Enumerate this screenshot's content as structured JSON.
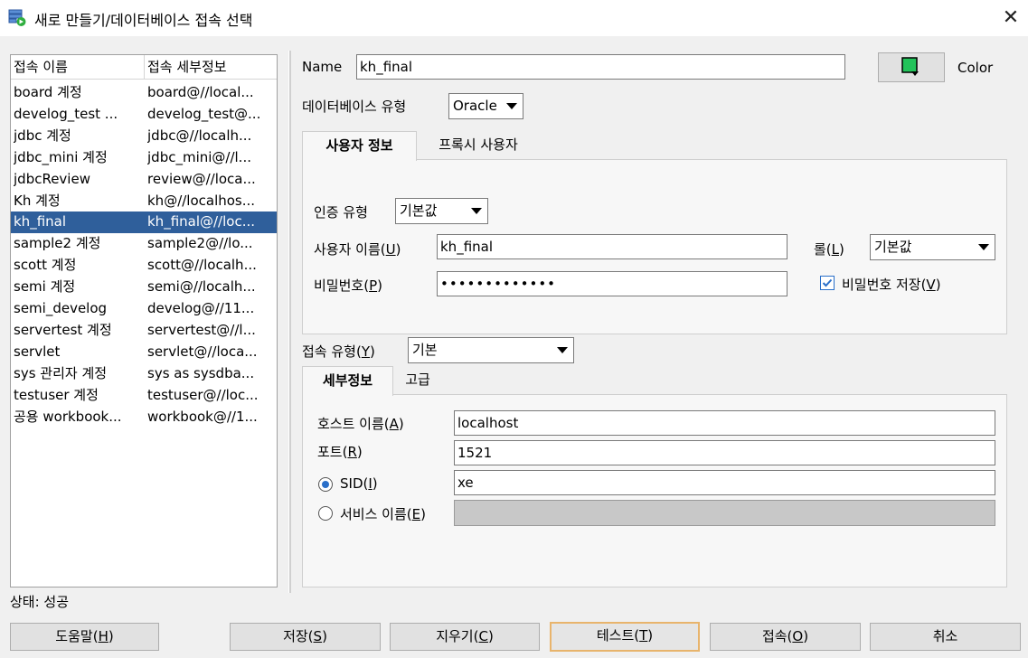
{
  "window": {
    "title": "새로 만들기/데이터베이스 접속 선택",
    "close_glyph": "✕"
  },
  "list": {
    "headers": [
      "접속 이름",
      "접속 세부정보"
    ],
    "rows": [
      [
        "board 계정",
        "board@//local..."
      ],
      [
        "develog_test ...",
        "develog_test@..."
      ],
      [
        "jdbc 계정",
        "jdbc@//localh..."
      ],
      [
        "jdbc_mini 계정",
        "jdbc_mini@//l..."
      ],
      [
        "jdbcReview",
        "review@//loca..."
      ],
      [
        "Kh 계정",
        "kh@//localhos..."
      ],
      [
        "kh_final",
        "kh_final@//loc..."
      ],
      [
        "sample2 계정",
        "sample2@//lo..."
      ],
      [
        "scott 계정",
        "scott@//localh..."
      ],
      [
        "semi 계정",
        "semi@//localh..."
      ],
      [
        "semi_develog",
        "develog@//11..."
      ],
      [
        "servertest 계정",
        "servertest@//l..."
      ],
      [
        "servlet",
        "servlet@//loca..."
      ],
      [
        "sys 관리자 계정",
        "sys as sysdba..."
      ],
      [
        "testuser 계정",
        "testuser@//loc..."
      ],
      [
        "공용 workbook...",
        "workbook@//1..."
      ]
    ],
    "selected_index": 6
  },
  "form": {
    "name_label": "Name",
    "name_value": "kh_final",
    "color_label": "Color",
    "color_swatch": "#22c35a",
    "db_type_label": "데이터베이스 유형",
    "db_type_value": "Oracle",
    "user_tabs": [
      "사용자 정보",
      "프록시 사용자"
    ],
    "auth_type_label": "인증 유형",
    "auth_type_value": "기본값",
    "username_label_pre": "사용자 이름(",
    "username_label_key": "U",
    "username_label_post": ")",
    "username_value": "kh_final",
    "role_label_pre": "롤(",
    "role_label_key": "L",
    "role_label_post": ")",
    "role_value": "기본값",
    "password_label_pre": "비밀번호(",
    "password_label_key": "P",
    "password_label_post": ")",
    "password_value": "•••••••••••••",
    "save_password_pre": "비밀번호 저장(",
    "save_password_key": "V",
    "save_password_post": ")",
    "save_password_checked": true,
    "conn_type_label_pre": "접속 유형(",
    "conn_type_label_key": "Y",
    "conn_type_label_post": ")",
    "conn_type_value": "기본",
    "detail_tabs": [
      "세부정보",
      "고급"
    ],
    "host_label_pre": "호스트 이름(",
    "host_label_key": "A",
    "host_label_post": ")",
    "host_value": "localhost",
    "port_label_pre": "포트(",
    "port_label_key": "R",
    "port_label_post": ")",
    "port_value": "1521",
    "sid_label_pre": "SID(",
    "sid_label_key": "I",
    "sid_label_post": ")",
    "sid_value": "xe",
    "service_label_pre": "서비스 이름(",
    "service_label_key": "E",
    "service_label_post": ")",
    "service_value": "",
    "selected_radio": "SID"
  },
  "status": {
    "text": "상태: 성공"
  },
  "buttons": {
    "help": {
      "pre": "도움말(",
      "key": "H",
      "post": ")"
    },
    "save": {
      "pre": "저장(",
      "key": "S",
      "post": ")"
    },
    "clear": {
      "pre": "지우기(",
      "key": "C",
      "post": ")"
    },
    "test": {
      "pre": "테스트(",
      "key": "T",
      "post": ")"
    },
    "connect": {
      "pre": "접속(",
      "key": "O",
      "post": ")"
    },
    "cancel": {
      "label": "취소"
    }
  }
}
